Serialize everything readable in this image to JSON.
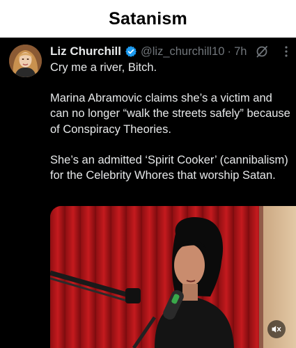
{
  "page": {
    "title": "Satanism"
  },
  "tweet": {
    "author_name": "Liz Churchill",
    "handle": "@liz_churchill10",
    "separator": "·",
    "time": "7h",
    "paragraphs": [
      "Cry me a river, Bitch.",
      "Marina Abramovic claims she’s a victim and can no longer “walk the streets safely” because of Conspiracy Theories.",
      "She’s an admitted ‘Spirit Cooker’ (cannibalism) for the Celebrity Whores that worship Satan."
    ]
  },
  "icons": {
    "verified": "verified-badge-icon",
    "grok": "slashed-circle-icon",
    "more": "more-vertical-icon",
    "mute": "speaker-muted-icon"
  },
  "colors": {
    "verified_blue": "#1d9bf0",
    "text_primary": "#e7e9ea",
    "text_secondary": "#71767b",
    "curtain_red": "#b5161a"
  }
}
